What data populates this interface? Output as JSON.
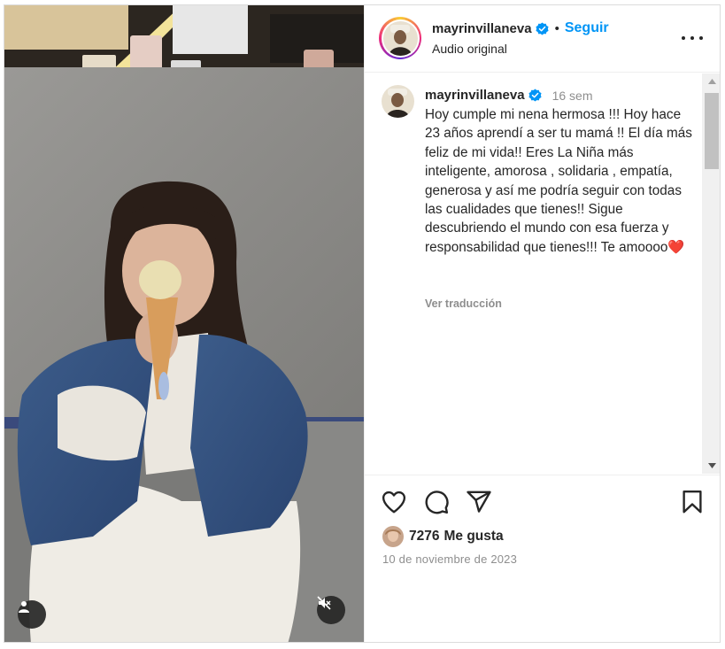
{
  "post": {
    "username": "mayrinvillaneva",
    "follow_label": "Seguir",
    "dot": "•",
    "audio": "Audio original"
  },
  "caption": {
    "username": "mayrinvillaneva",
    "time": "16 sem",
    "text": "Hoy cumple mi nena hermosa !!! Hoy hace 23 años aprendí a ser tu mamá !! El día más feliz de mi vida!! Eres La Niña más inteligente, amorosa , solidaria , empatía, generosa y así me podría seguir con todas las cualidades que tienes!! Sigue descubriendo el mundo con esa fuerza y responsabilidad que tienes!!! Te amoooo",
    "emoji": "❤️",
    "translate_label": "Ver traducción"
  },
  "stats": {
    "likes_count": "7276",
    "likes_label": "Me gusta",
    "date": "10 de noviembre de 2023"
  },
  "icons": {
    "verified": "verified-badge-icon",
    "more": "more-options-icon",
    "like": "heart-icon",
    "comment": "comment-icon",
    "share": "share-icon",
    "save": "bookmark-icon",
    "tag": "user-tag-icon",
    "mute": "muted-speaker-icon"
  },
  "colors": {
    "accent": "#0095f6",
    "text": "#262626",
    "secondary": "#8e8e8e",
    "heart": "#e0202e"
  }
}
